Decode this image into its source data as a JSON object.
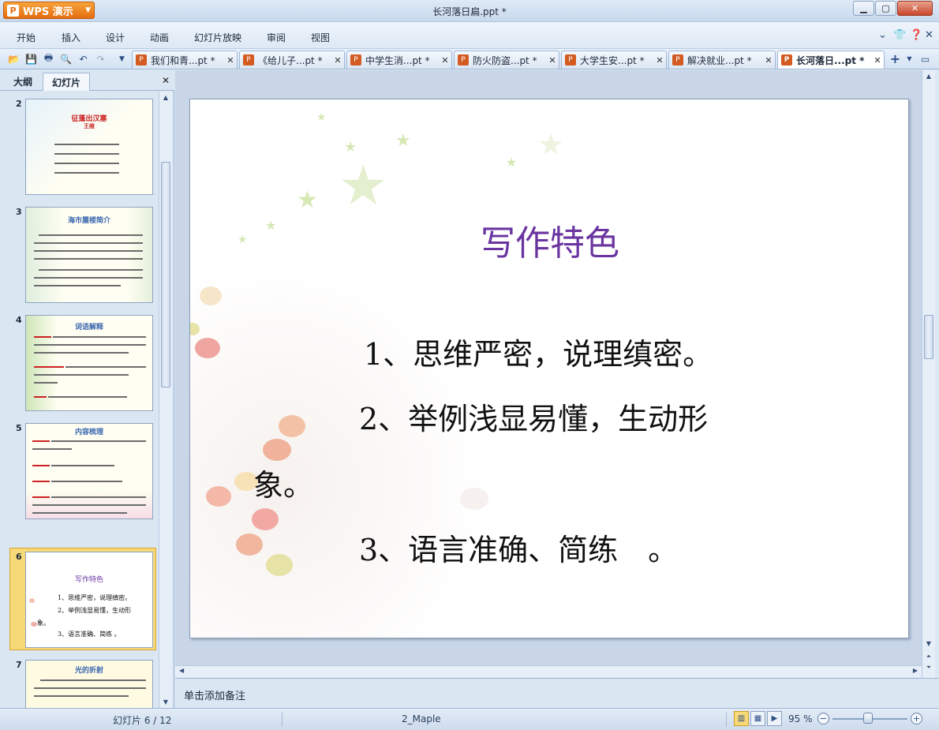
{
  "app": {
    "brand": "WPS 演示",
    "window_title": "长河落日扁.ppt *"
  },
  "menu": [
    "开始",
    "插入",
    "设计",
    "动画",
    "幻灯片放映",
    "审阅",
    "视图"
  ],
  "doc_tabs": [
    {
      "label": "我们和青...pt *",
      "active": false
    },
    {
      "label": "《给儿子...pt *",
      "active": false
    },
    {
      "label": "中学生消...pt *",
      "active": false
    },
    {
      "label": "防火防盗...pt *",
      "active": false
    },
    {
      "label": "大学生安...pt *",
      "active": false
    },
    {
      "label": "解决就业...pt *",
      "active": false
    },
    {
      "label": "长河落日...pt *",
      "active": true
    }
  ],
  "panel": {
    "tabs": [
      "大纲",
      "幻灯片"
    ],
    "active_tab": "幻灯片"
  },
  "thumbnails": [
    {
      "num": "2",
      "title": "征蓬出汉塞",
      "subtitle": "王维"
    },
    {
      "num": "3",
      "title": "海市蜃楼简介"
    },
    {
      "num": "4",
      "title": "词语解释"
    },
    {
      "num": "5",
      "title": "内容梳理"
    },
    {
      "num": "6",
      "title": "写作特色",
      "lines": [
        "1、思维严密，说理缜密。",
        "2、举例浅显易懂，生动形",
        "象。",
        "3、语言准确、简练 。"
      ],
      "selected": true
    },
    {
      "num": "7",
      "title": "光的折射"
    }
  ],
  "slide": {
    "title": "写作特色",
    "lines": [
      "1、思维严密，说理缜密。",
      "2、举例浅显易懂，生动形",
      "象。",
      "3、语言准确、简练　。"
    ]
  },
  "notes_placeholder": "单击添加备注",
  "status": {
    "slide_counter": "幻灯片 6 / 12",
    "theme": "2_Maple",
    "zoom": "95 %"
  },
  "colors": {
    "slide_title": "#6a35a0",
    "accent_orange": "#e56d10",
    "selection": "#f7d977"
  }
}
